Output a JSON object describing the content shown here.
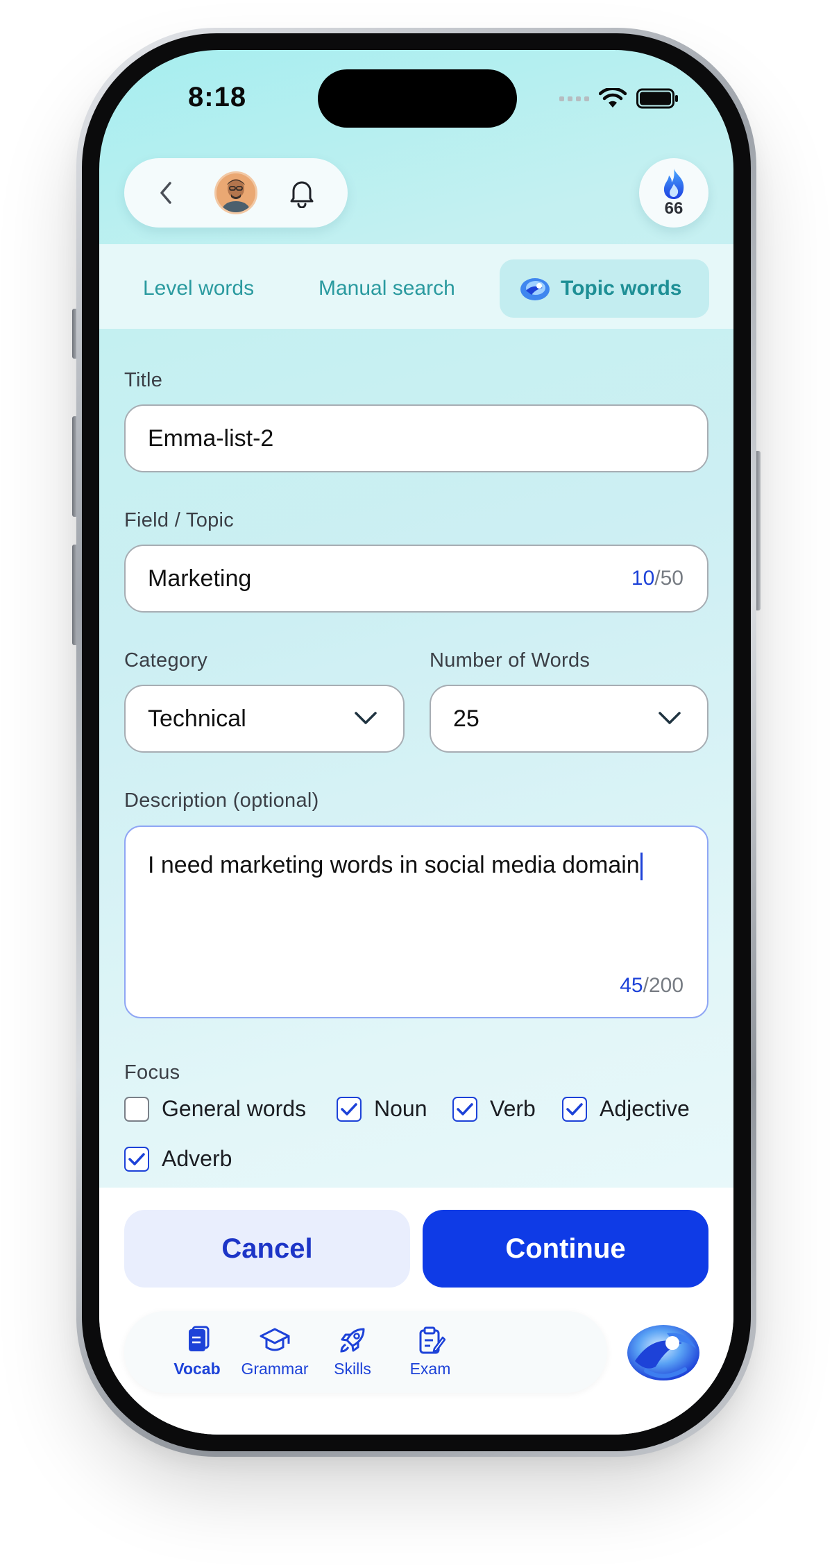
{
  "status_bar": {
    "time": "8:18"
  },
  "header": {
    "streak_count": "66"
  },
  "tabs": [
    {
      "label": "Level words"
    },
    {
      "label": "Manual search"
    },
    {
      "label": "Topic words"
    }
  ],
  "form": {
    "title": {
      "label": "Title",
      "value": "Emma-list-2"
    },
    "topic": {
      "label": "Field / Topic",
      "value": "Marketing",
      "count": "10",
      "max": "/50"
    },
    "category": {
      "label": "Category",
      "value": "Technical"
    },
    "word_count": {
      "label": "Number of Words",
      "value": "25"
    },
    "description": {
      "label": "Description (optional)",
      "value": "I need marketing words in social media domain",
      "count": "45",
      "max": "/200"
    },
    "focus": {
      "label": "Focus",
      "options": [
        {
          "label": "General words",
          "checked": false
        },
        {
          "label": "Noun",
          "checked": true
        },
        {
          "label": "Verb",
          "checked": true
        },
        {
          "label": "Adjective",
          "checked": true
        },
        {
          "label": "Adverb",
          "checked": true
        }
      ]
    }
  },
  "actions": {
    "cancel": "Cancel",
    "continue": "Continue"
  },
  "bottom_nav": [
    {
      "label": "Vocab",
      "icon": "vocab-icon",
      "active": true
    },
    {
      "label": "Grammar",
      "icon": "graduation-cap-icon",
      "active": false
    },
    {
      "label": "Skills",
      "icon": "rocket-icon",
      "active": false
    },
    {
      "label": "Exam",
      "icon": "clipboard-icon",
      "active": false
    }
  ],
  "colors": {
    "accent": "#0f3be6",
    "teal": "#2a9a9f",
    "background": "#c4f0f1"
  }
}
